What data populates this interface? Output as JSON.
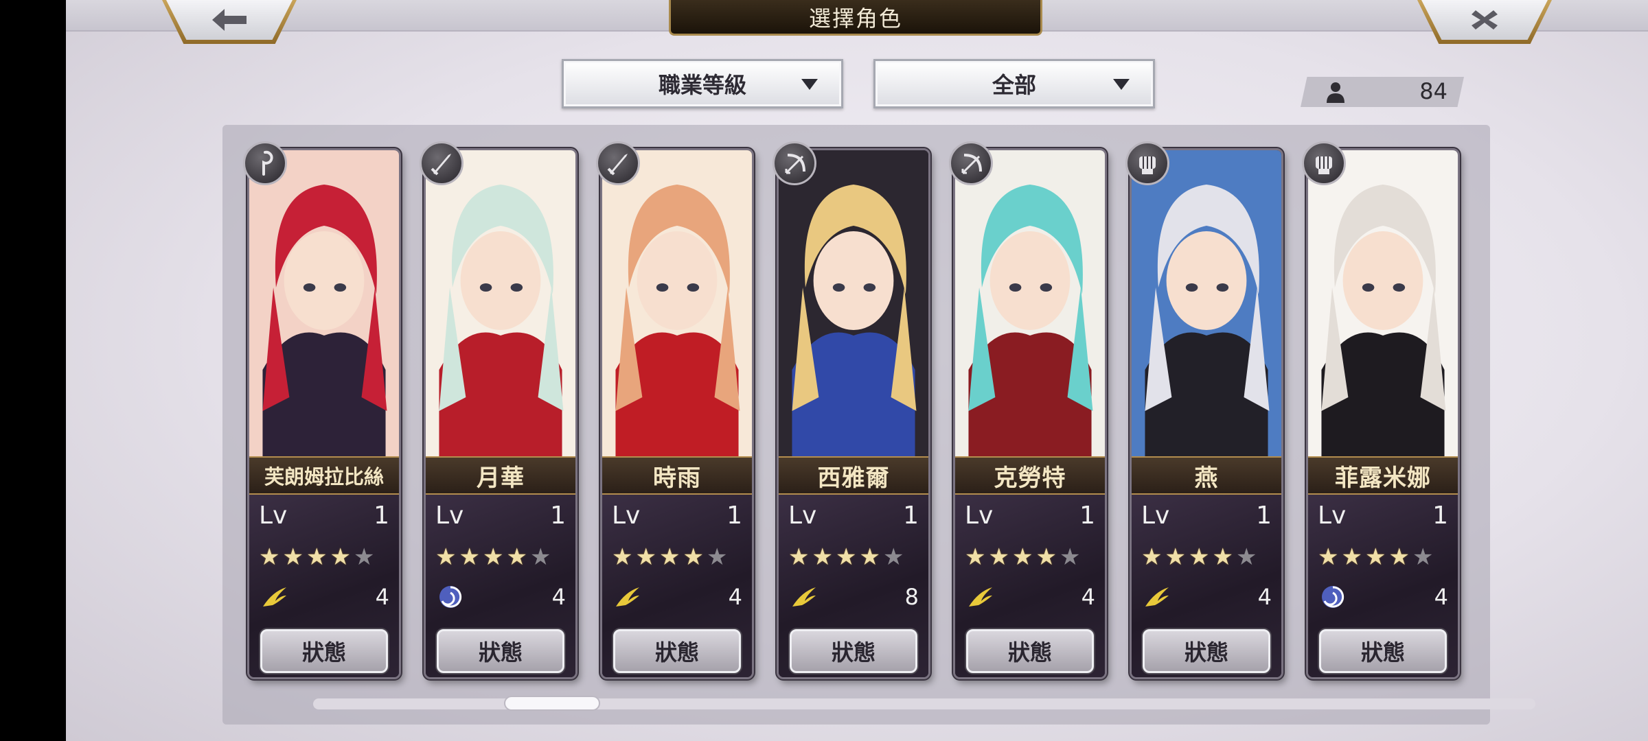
{
  "header": {
    "title": "選擇角色",
    "back_icon": "arrow-left-icon",
    "close_icon": "close-icon"
  },
  "filters": {
    "job_filter": "職業等級",
    "type_filter": "全部"
  },
  "roster_count": "84",
  "cards": [
    {
      "name": "芙朗姆拉比絲",
      "lv_label": "Lv",
      "level": "1",
      "stars": 4,
      "element": "wind",
      "cost": "4",
      "status_label": "狀態",
      "class_icon": "staff-icon",
      "palette": [
        "#c62036",
        "#f3d2c6",
        "#2d2238"
      ]
    },
    {
      "name": "月華",
      "lv_label": "Lv",
      "level": "1",
      "stars": 4,
      "element": "water",
      "cost": "4",
      "status_label": "狀態",
      "class_icon": "sword-icon",
      "palette": [
        "#cfe6dc",
        "#f6efe5",
        "#b81e2a"
      ]
    },
    {
      "name": "時雨",
      "lv_label": "Lv",
      "level": "1",
      "stars": 4,
      "element": "wind",
      "cost": "4",
      "status_label": "狀態",
      "class_icon": "sword-icon",
      "palette": [
        "#e8a57c",
        "#f7e8d8",
        "#c01d25"
      ]
    },
    {
      "name": "西雅爾",
      "lv_label": "Lv",
      "level": "1",
      "stars": 4,
      "element": "wind",
      "cost": "8",
      "status_label": "狀態",
      "class_icon": "bow-icon",
      "palette": [
        "#e9c880",
        "#2c2730",
        "#3149a8"
      ]
    },
    {
      "name": "克勞特",
      "lv_label": "Lv",
      "level": "1",
      "stars": 4,
      "element": "wind",
      "cost": "4",
      "status_label": "狀態",
      "class_icon": "bow-icon",
      "palette": [
        "#6ad0cc",
        "#f1efe9",
        "#8a1c22"
      ]
    },
    {
      "name": "燕",
      "lv_label": "Lv",
      "level": "1",
      "stars": 4,
      "element": "wind",
      "cost": "4",
      "status_label": "狀態",
      "class_icon": "fist-icon",
      "palette": [
        "#e2e2ea",
        "#4e7cc2",
        "#222028"
      ]
    },
    {
      "name": "菲露米娜",
      "lv_label": "Lv",
      "level": "1",
      "stars": 4,
      "element": "water",
      "cost": "4",
      "status_label": "狀態",
      "class_icon": "fist-icon",
      "palette": [
        "#e3ddd7",
        "#f6f3ef",
        "#1e1b20"
      ]
    }
  ],
  "colors": {
    "gold": "#c9a45a",
    "star_on": "#f0dfa8",
    "star_off": "#8c8a90"
  }
}
